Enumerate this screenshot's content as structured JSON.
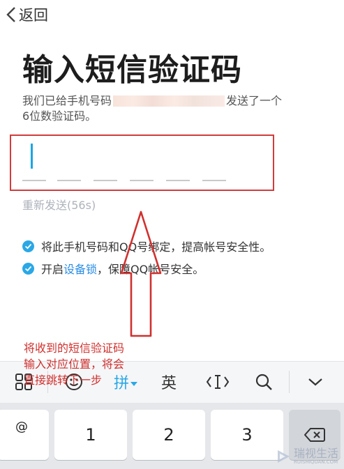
{
  "header": {
    "back_label": "返回"
  },
  "page": {
    "title": "输入短信验证码",
    "desc_prefix": "我们已给手机号码",
    "desc_suffix": "发送了一个",
    "desc_line2": "6位数验证码。"
  },
  "code_input": {
    "digits": [
      "",
      "",
      "",
      "",
      "",
      ""
    ]
  },
  "resend": {
    "label": "重新发送(56s)"
  },
  "options": [
    {
      "text": "将此手机号码和QQ号绑定，提高帐号安全性。"
    },
    {
      "text_before": "开启",
      "link": "设备锁",
      "text_after": "，保障QQ帐号安全。"
    }
  ],
  "annotation": {
    "line1": "将收到的短信验证码",
    "line2": "输入对应位置，将会",
    "line3": "直接跳转下一步"
  },
  "keyboard": {
    "toolbar": {
      "pinyin": "拼",
      "english": "英"
    },
    "keys": {
      "symbol": "@",
      "k1": "1",
      "k2": "2",
      "k3": "3"
    }
  },
  "watermark": {
    "title": "瑞视生活",
    "sub": "RUISHIQUAN.COM"
  },
  "colors": {
    "accent": "#2aa8e6",
    "annotation_red": "#d0312e",
    "link": "#2a8ee6"
  }
}
